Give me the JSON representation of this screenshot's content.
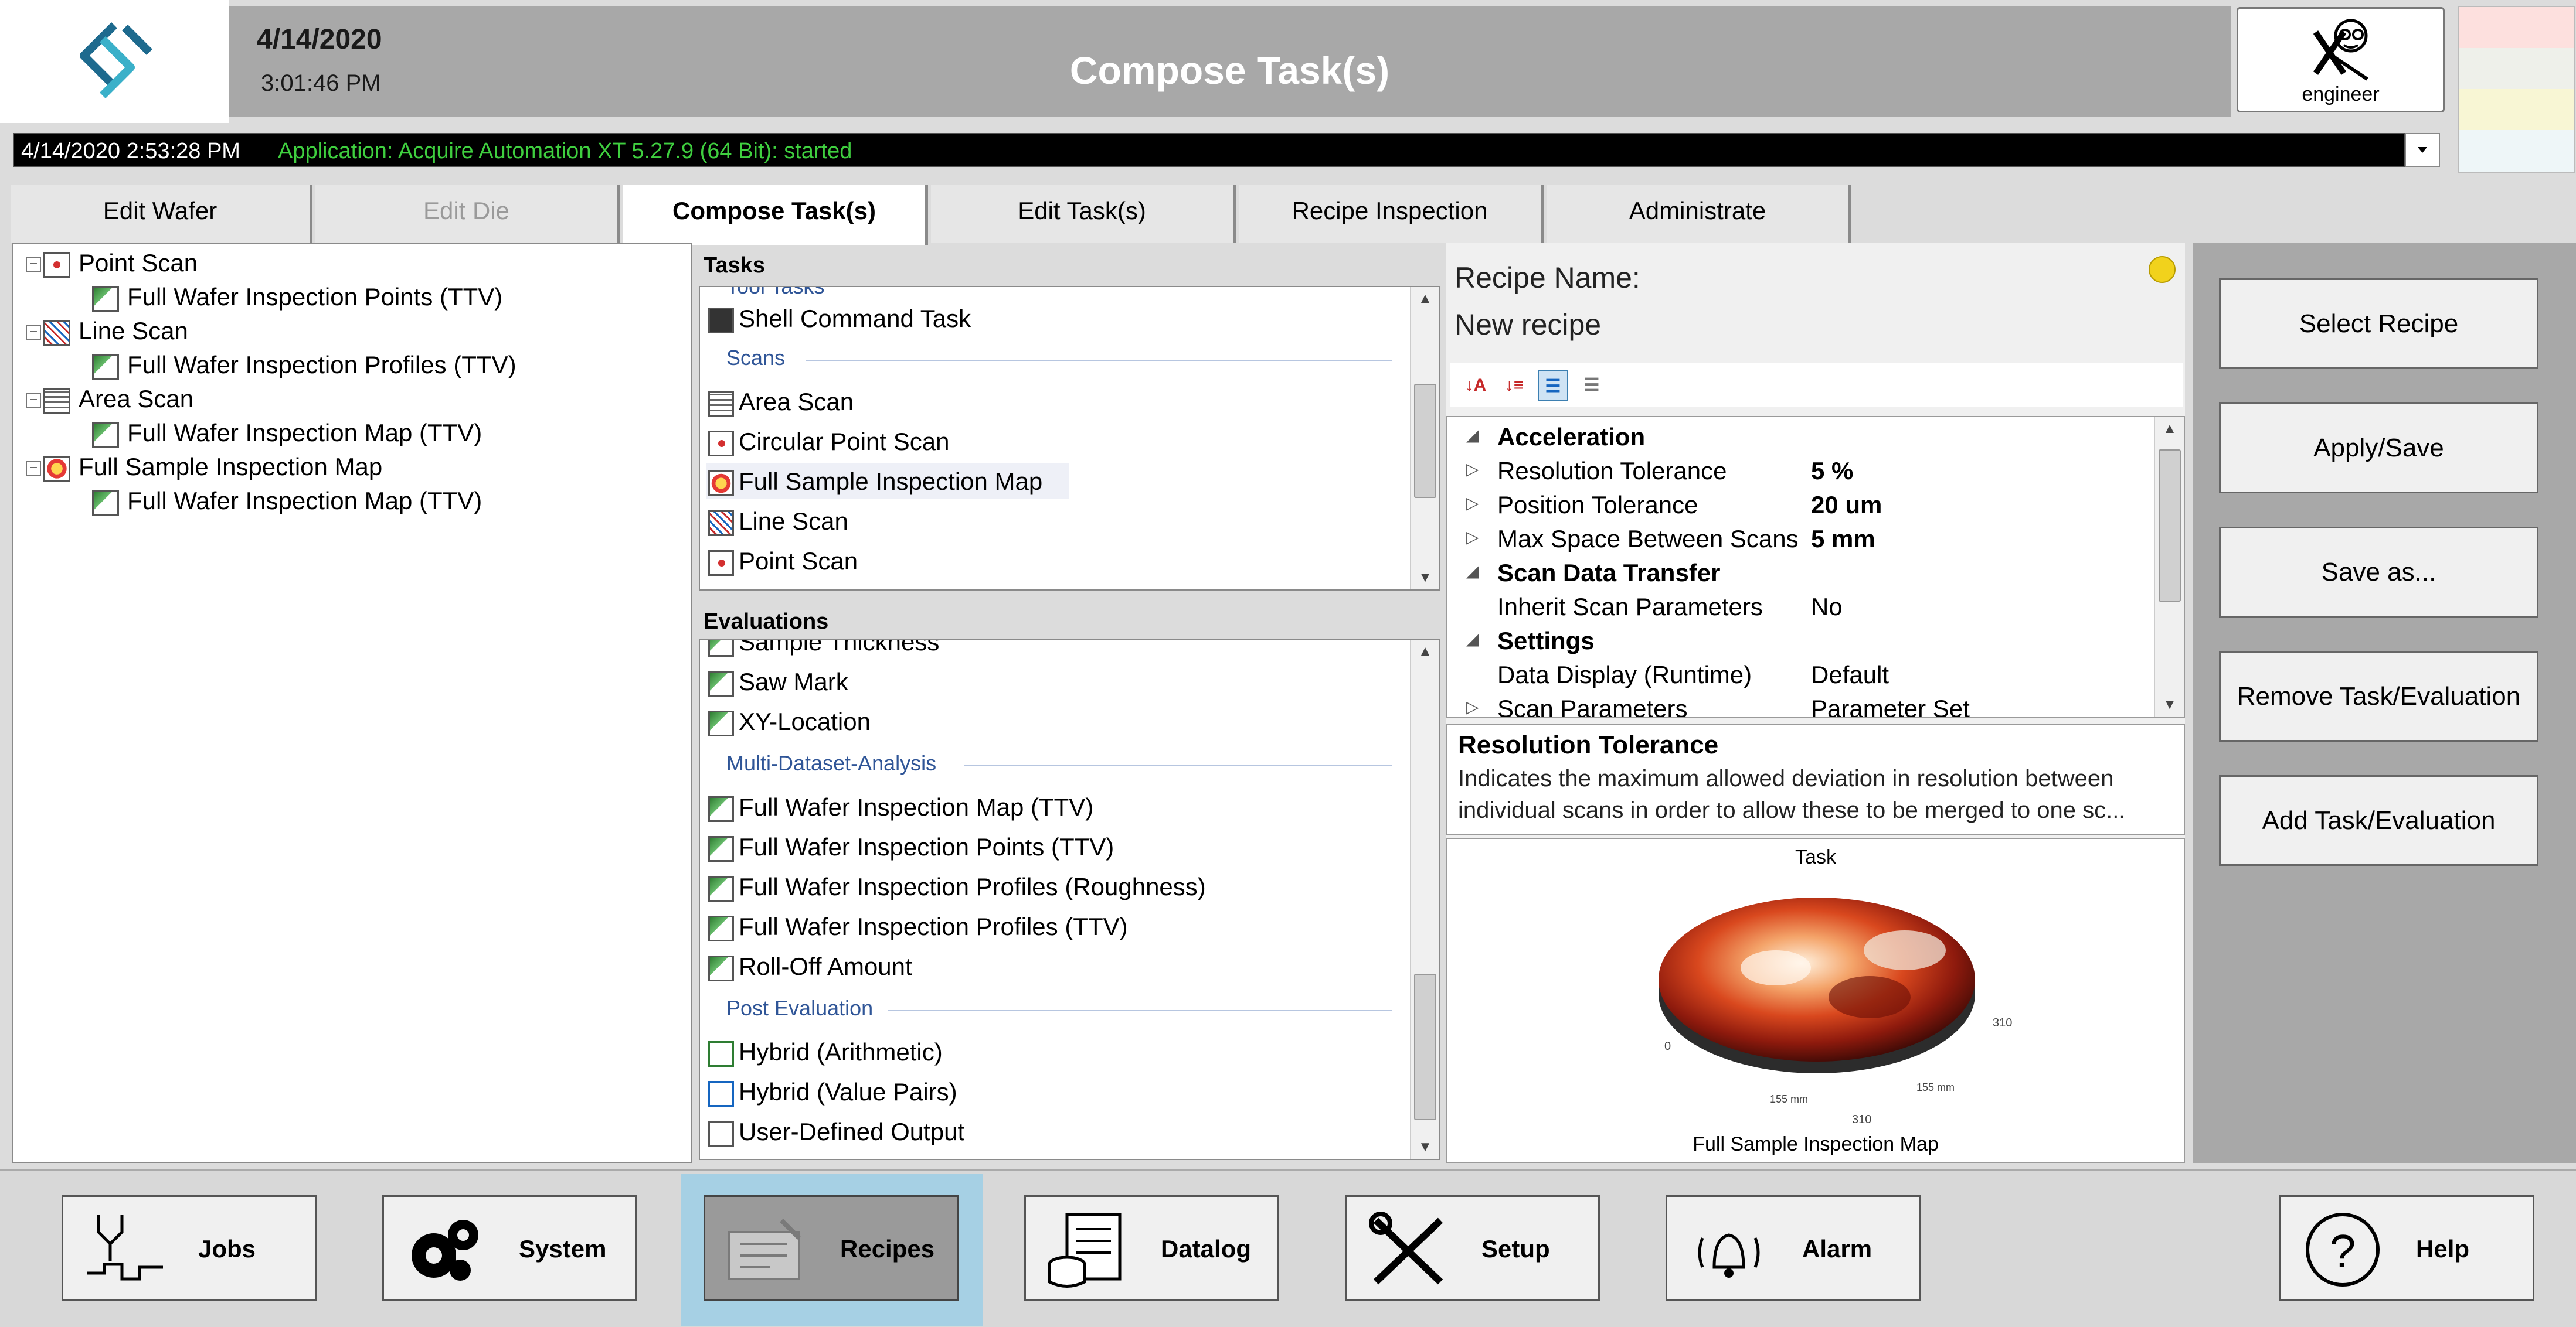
{
  "header": {
    "date": "4/14/2020",
    "time": "3:01:46 PM",
    "title": "Compose Task(s)",
    "user_role": "engineer"
  },
  "log": {
    "timestamp": "4/14/2020 2:53:28 PM",
    "message": "Application: Acquire Automation XT 5.27.9 (64 Bit): started"
  },
  "tabs": [
    {
      "label": "Edit Wafer",
      "state": "normal"
    },
    {
      "label": "Edit Die",
      "state": "disabled"
    },
    {
      "label": "Compose Task(s)",
      "state": "active"
    },
    {
      "label": "Edit Task(s)",
      "state": "normal"
    },
    {
      "label": "Recipe Inspection",
      "state": "normal"
    },
    {
      "label": "Administrate",
      "state": "normal"
    }
  ],
  "tree": [
    {
      "label": "Point Scan",
      "children": [
        "Full Wafer Inspection Points (TTV)"
      ]
    },
    {
      "label": "Line Scan",
      "children": [
        "Full Wafer Inspection Profiles (TTV)"
      ]
    },
    {
      "label": "Area Scan",
      "children": [
        "Full Wafer Inspection Map (TTV)"
      ]
    },
    {
      "label": "Full Sample Inspection Map",
      "children": [
        "Full Wafer Inspection Map (TTV)"
      ]
    }
  ],
  "tasks": {
    "heading": "Tasks",
    "partial_top": "Tool Tasks",
    "shell_item": "Shell Command Task",
    "group": "Scans",
    "items": [
      "Area Scan",
      "Circular Point Scan",
      "Full Sample Inspection Map",
      "Line Scan",
      "Point Scan"
    ]
  },
  "evaluations": {
    "heading": "Evaluations",
    "partial_top": "Sample Thickness",
    "top_items": [
      "Saw Mark",
      "XY-Location"
    ],
    "group1": "Multi-Dataset-Analysis",
    "group1_items": [
      "Full Wafer Inspection Map (TTV)",
      "Full Wafer Inspection Points (TTV)",
      "Full Wafer Inspection Profiles (Roughness)",
      "Full Wafer Inspection Profiles (TTV)",
      "Roll-Off Amount"
    ],
    "group2": "Post Evaluation",
    "group2_items": [
      "Hybrid (Arithmetic)",
      "Hybrid (Value Pairs)",
      "User-Defined Output"
    ]
  },
  "recipe": {
    "label": "Recipe Name:",
    "name": "New recipe",
    "status_color": "#f1d21c"
  },
  "props": [
    {
      "name": "Acceleration",
      "value": "",
      "category": true
    },
    {
      "name": "Resolution Tolerance",
      "value": "5 %",
      "bold_value": true
    },
    {
      "name": "Position Tolerance",
      "value": "20 um",
      "bold_value": true
    },
    {
      "name": "Max Space Between Scans",
      "value": "5 mm",
      "bold_value": true
    },
    {
      "name": "Scan Data Transfer",
      "value": "",
      "category": true
    },
    {
      "name": "Inherit Scan Parameters",
      "value": "No"
    },
    {
      "name": "Settings",
      "value": "",
      "category": true
    },
    {
      "name": "Data Display (Runtime)",
      "value": "Default"
    },
    {
      "name": "Scan Parameters",
      "value": "Parameter Set"
    }
  ],
  "description": {
    "title": "Resolution Tolerance",
    "text": "Indicates the maximum allowed deviation in resolution between individual scans in order to allow these to be merged to one sc..."
  },
  "preview": {
    "top_label": "Task",
    "bottom_label": "Full Sample Inspection Map",
    "axis_labels": [
      "0",
      "310",
      "155 mm",
      "155 mm",
      "310"
    ]
  },
  "side_buttons": [
    "Select Recipe",
    "Apply/Save",
    "Save as...",
    "Remove Task/Evaluation",
    "Add Task/Evaluation"
  ],
  "nav": [
    "Jobs",
    "System",
    "Recipes",
    "Datalog",
    "Setup",
    "Alarm",
    "Help"
  ],
  "colors": {
    "header_gray": "#a8a8a8",
    "log_text": "#3fcf3f",
    "active_nav": "#a6d0e4",
    "group_blue": "#2f5597"
  }
}
